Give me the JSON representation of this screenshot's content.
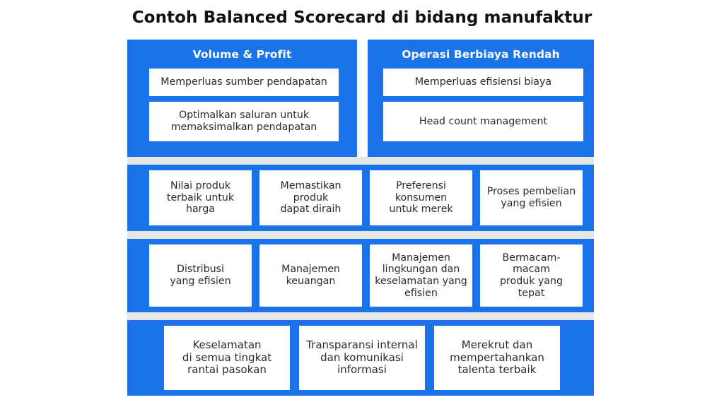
{
  "title": "Contoh Balanced Scorecard di bidang manufaktur",
  "theme": {
    "accent": "#1a73e8",
    "panel_gap": "#e8e6e6",
    "card_bg": "#ffffff",
    "page_bg": "#ffffff",
    "heading_text": "#ffffff",
    "body_text": "#2b2b2b",
    "title_text": "#111111"
  },
  "rows": [
    {
      "id": "financial",
      "panels": [
        {
          "id": "volume-profit",
          "heading": "Volume & Profit",
          "cells": [
            "Memperluas sumber pendapatan",
            "Optimalkan saluran untuk\nmemaksimalkan pendapatan"
          ]
        },
        {
          "id": "low-cost-operations",
          "heading": "Operasi Berbiaya Rendah",
          "cells": [
            "Memperluas efisiensi biaya",
            "Head count management"
          ]
        }
      ]
    },
    {
      "id": "customer",
      "panels": [
        {
          "id": "customer-panel",
          "heading": "",
          "cells": [
            "Nilai produk\nterbaik untuk\nharga",
            "Memastikan\nproduk\ndapat diraih",
            "Preferensi\nkonsumen\nuntuk merek",
            "Proses pembelian\nyang efisien"
          ]
        }
      ]
    },
    {
      "id": "internal-process",
      "panels": [
        {
          "id": "internal-process-panel",
          "heading": "",
          "cells": [
            "Distribusi\nyang efisien",
            "Manajemen\nkeuangan",
            "Manajemen\nlingkungan dan\nkeselamatan yang\nefisien",
            "Bermacam-macam\nproduk yang\ntepat"
          ]
        }
      ]
    },
    {
      "id": "learning-growth",
      "panels": [
        {
          "id": "learning-growth-panel",
          "heading": "",
          "cells": [
            "Keselamatan\ndi semua tingkat\nrantai pasokan",
            "Transparansi internal\ndan komunikasi\ninformasi",
            "Merekrut dan\nmempertahankan\ntalenta terbaik"
          ]
        }
      ]
    }
  ]
}
